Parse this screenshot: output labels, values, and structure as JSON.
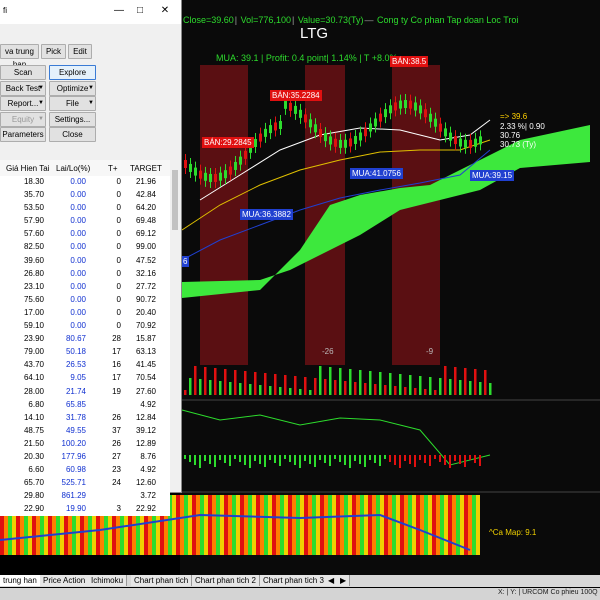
{
  "chart": {
    "info_close": "Close=39.60",
    "info_vol": "Vol=776,100",
    "info_value": "Value=30.73(Ty)",
    "info_company": "Cong ty Co phan Tap doan Loc Troi",
    "title": "LTG",
    "banner": "MUA:  39.1  | Profit: 0.4 point| 1.14% | T +8.0%",
    "annotations": {
      "ban_top": "BÁN:38.5",
      "ban_mid": "BÁN:35.2284",
      "ban_left": "BÁN:29.2845",
      "mua_41": "MUA:41.0756",
      "mua_39": "MUA:39.15",
      "mua_36": "MUA:36.3882",
      "mua_edge": "6"
    },
    "right_values": {
      "arrow": "=>  39.6",
      "pct": "2.33 %| 0.90",
      "v1": "30.76",
      "v2": "30.73 (Ty)"
    },
    "dates": [
      "-26",
      "-9"
    ],
    "camap": "^Ca Map: 9.1",
    "colors": {
      "cloud": "#3de83d",
      "sell_zone": "#5a0f12",
      "buy": "#2040d0",
      "sell": "#e01010"
    }
  },
  "window": {
    "title_fragment": "fi",
    "buttons": {
      "vatrunghan": "va trung han",
      "pick": "Pick",
      "edit": "Edit",
      "scan": "Scan",
      "explore": "Explore",
      "backtest": "Back Test",
      "optimize": "Optimize",
      "report": "Report...",
      "file": "File",
      "equity": "Equity",
      "settings": "Settings...",
      "parameters": "Parameters",
      "close": "Close"
    },
    "columns": [
      "Giá Hien Tai",
      "Lai/Lo(%)",
      "T+",
      "TARGET"
    ],
    "rows": [
      [
        "18.30",
        "0.00",
        "0",
        "21.96"
      ],
      [
        "35.70",
        "0.00",
        "0",
        "42.84"
      ],
      [
        "53.50",
        "0.00",
        "0",
        "64.20"
      ],
      [
        "57.90",
        "0.00",
        "0",
        "69.48"
      ],
      [
        "57.60",
        "0.00",
        "0",
        "69.12"
      ],
      [
        "82.50",
        "0.00",
        "0",
        "99.00"
      ],
      [
        "39.60",
        "0.00",
        "0",
        "47.52"
      ],
      [
        "26.80",
        "0.00",
        "0",
        "32.16"
      ],
      [
        "23.10",
        "0.00",
        "0",
        "27.72"
      ],
      [
        "75.60",
        "0.00",
        "0",
        "90.72"
      ],
      [
        "17.00",
        "0.00",
        "0",
        "20.40"
      ],
      [
        "59.10",
        "0.00",
        "0",
        "70.92"
      ],
      [
        "23.90",
        "80.67",
        "28",
        "15.87"
      ],
      [
        "79.00",
        "50.18",
        "17",
        "63.13"
      ],
      [
        "43.70",
        "26.53",
        "16",
        "41.45"
      ],
      [
        "64.10",
        "9.05",
        "17",
        "70.54"
      ],
      [
        "28.00",
        "21.74",
        "19",
        "27.60"
      ],
      [
        "6.80",
        "65.85",
        "",
        "4.92"
      ],
      [
        "14.10",
        "31.78",
        "26",
        "12.84"
      ],
      [
        "48.75",
        "49.55",
        "37",
        "39.12"
      ],
      [
        "21.50",
        "100.20",
        "26",
        "12.89"
      ],
      [
        "20.30",
        "177.96",
        "27",
        "8.76"
      ],
      [
        "6.60",
        "60.98",
        "23",
        "4.92"
      ],
      [
        "65.70",
        "525.71",
        "24",
        "12.60"
      ],
      [
        "29.80",
        "861.29",
        "",
        "3.72"
      ],
      [
        "22.90",
        "19.90",
        "3",
        "22.92"
      ]
    ]
  },
  "tabs": [
    "trung han",
    "Price Action",
    "Ichimoku",
    "Chart phan tich",
    "Chart phan tich 2",
    "Chart phan tich 3"
  ],
  "status": "X: | Y: | URCOM Co phieu 100Q"
}
